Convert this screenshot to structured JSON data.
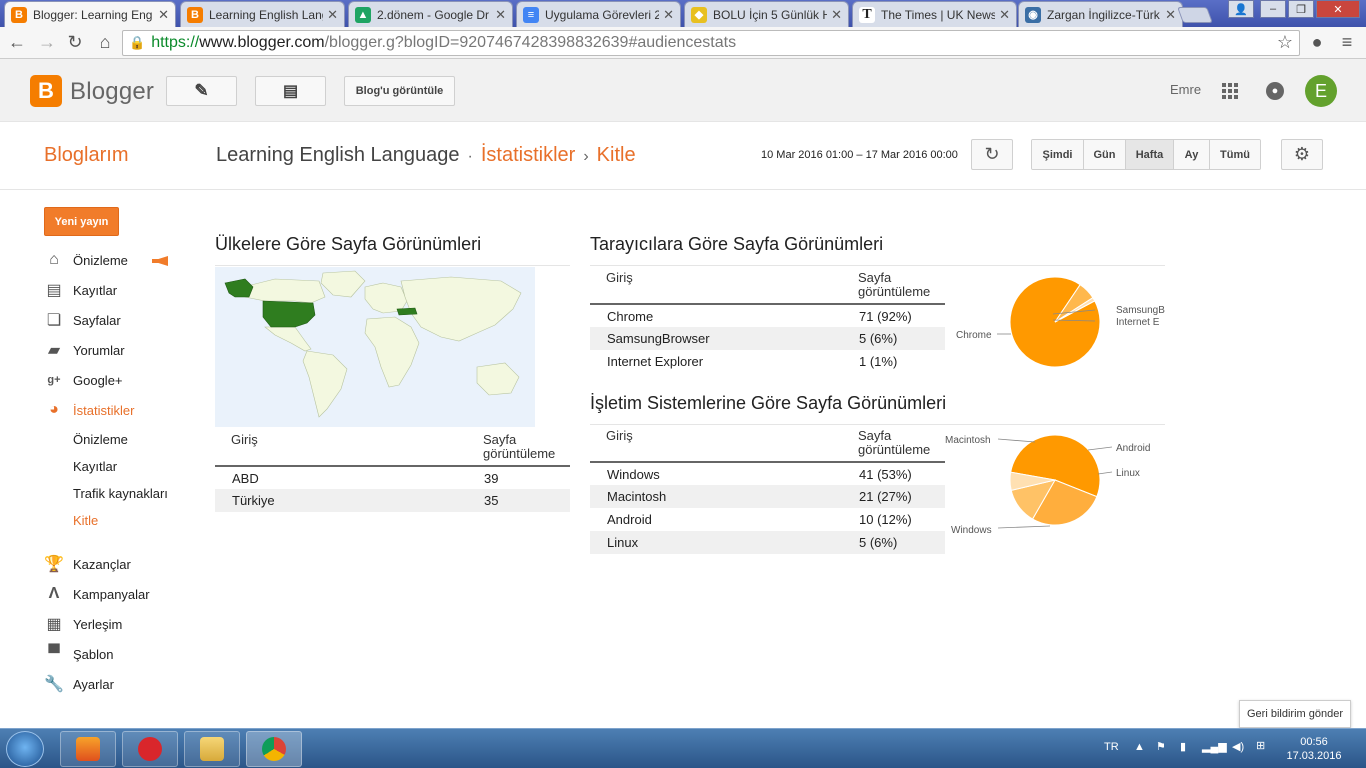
{
  "browser": {
    "tabs": [
      {
        "title": "Blogger: Learning Eng",
        "active": true,
        "icon": "blogger-icon",
        "color": "#f57d00"
      },
      {
        "title": "Learning English Lang",
        "active": false,
        "icon": "blogger-icon",
        "color": "#f57d00"
      },
      {
        "title": "2.dönem - Google Dr",
        "active": false,
        "icon": "drive-icon",
        "color": "#1fa463"
      },
      {
        "title": "Uygulama Görevleri 2",
        "active": false,
        "icon": "docs-icon",
        "color": "#4285f4"
      },
      {
        "title": "BOLU İçin 5 Günlük H",
        "active": false,
        "icon": "shield-icon",
        "color": "#e8c020"
      },
      {
        "title": "The Times | UK News",
        "active": false,
        "icon": "times-icon",
        "color": "#222222"
      },
      {
        "title": "Zargan İngilizce-Türk",
        "active": false,
        "icon": "owl-icon",
        "color": "#3a6ea5"
      }
    ],
    "url": {
      "scheme": "https://",
      "host": "www.blogger.com",
      "path": "/blogger.g?blogID=9207467428398832639#audiencestats"
    }
  },
  "header": {
    "logo_text": "Blogger",
    "view_blog": "Blog'u görüntüle",
    "username": "Emre",
    "avatar_letter": "E"
  },
  "titlebar": {
    "my_blogs": "Bloglarım",
    "blog_name": "Learning English Language",
    "stats": "İstatistikler",
    "audience": "Kitle",
    "date_range": "10 Mar 2016 01:00 – 17 Mar 2016 00:00",
    "periods": [
      "Şimdi",
      "Gün",
      "Hafta",
      "Ay",
      "Tümü"
    ],
    "selected_period": "Hafta"
  },
  "sidebar": {
    "new_post": "Yeni yayın",
    "items": [
      {
        "label": "Önizleme",
        "icon": "home-icon"
      },
      {
        "label": "Kayıtlar",
        "icon": "posts-icon"
      },
      {
        "label": "Sayfalar",
        "icon": "pages-icon"
      },
      {
        "label": "Yorumlar",
        "icon": "comments-icon"
      },
      {
        "label": "Google+",
        "icon": "google-plus-icon"
      },
      {
        "label": "İstatistikler",
        "icon": "stats-pie-icon"
      }
    ],
    "sub_items": [
      "Önizleme",
      "Kayıtlar",
      "Trafik kaynakları",
      "Kitle"
    ],
    "items2": [
      {
        "label": "Kazançlar",
        "icon": "trophy-icon"
      },
      {
        "label": "Kampanyalar",
        "icon": "adwords-icon"
      },
      {
        "label": "Yerleşim",
        "icon": "layout-icon"
      },
      {
        "label": "Şablon",
        "icon": "paint-roller-icon"
      },
      {
        "label": "Ayarlar",
        "icon": "wrench-icon"
      }
    ]
  },
  "countries": {
    "title": "Ülkelere Göre Sayfa Görünümleri",
    "col1": "Giriş",
    "col2": "Sayfa görüntüleme",
    "rows": [
      {
        "name": "ABD",
        "value": "39"
      },
      {
        "name": "Türkiye",
        "value": "35"
      }
    ]
  },
  "browsers": {
    "title": "Tarayıcılara Göre Sayfa Görünümleri",
    "col1": "Giriş",
    "col2": "Sayfa görüntüleme",
    "rows": [
      {
        "name": "Chrome",
        "value": "71 (92%)"
      },
      {
        "name": "SamsungBrowser",
        "value": "5 (6%)"
      },
      {
        "name": "Internet Explorer",
        "value": "1 (1%)"
      }
    ],
    "pie_labels": [
      "Chrome",
      "SamsungB",
      "Internet E"
    ]
  },
  "os": {
    "title": "İşletim Sistemlerine Göre Sayfa Görünümleri",
    "col1": "Giriş",
    "col2": "Sayfa görüntüleme",
    "rows": [
      {
        "name": "Windows",
        "value": "41 (53%)"
      },
      {
        "name": "Macintosh",
        "value": "21 (27%)"
      },
      {
        "name": "Android",
        "value": "10 (12%)"
      },
      {
        "name": "Linux",
        "value": "5 (6%)"
      }
    ],
    "pie_labels": [
      "Macintosh",
      "Android",
      "Linux",
      "Windows"
    ]
  },
  "chart_data": [
    {
      "type": "pie",
      "categories": [
        "Chrome",
        "SamsungBrowser",
        "Internet Explorer"
      ],
      "values": [
        71,
        5,
        1
      ],
      "colors": [
        "#ff9900",
        "#ffb84d",
        "#ffe0b2"
      ]
    },
    {
      "type": "pie",
      "categories": [
        "Windows",
        "Macintosh",
        "Android",
        "Linux"
      ],
      "values": [
        41,
        21,
        10,
        5
      ],
      "colors": [
        "#ff9900",
        "#ffae3d",
        "#ffc266",
        "#ffe0b2"
      ]
    }
  ],
  "feedback": "Geri bildirim gönder",
  "taskbar": {
    "lang": "TR",
    "time": "00:56",
    "date": "17.03.2016"
  }
}
